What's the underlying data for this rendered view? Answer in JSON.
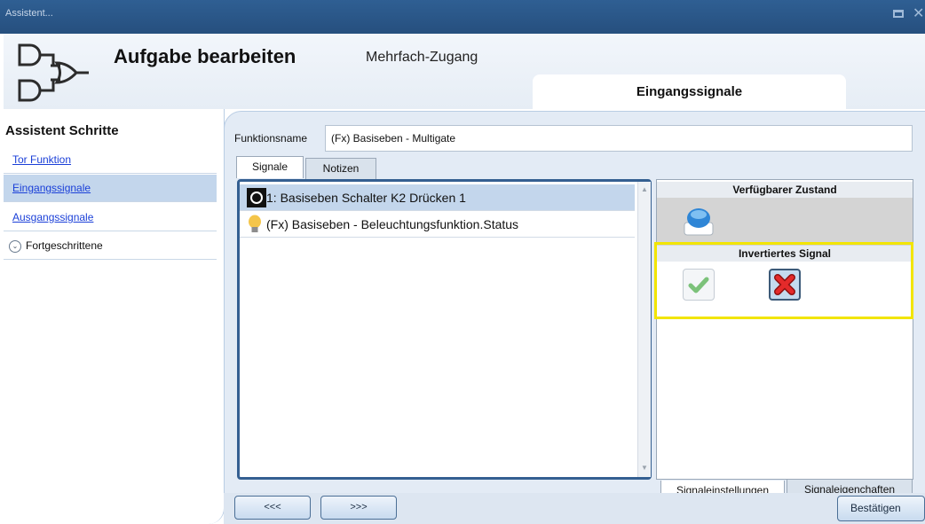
{
  "window": {
    "title": "Assistent...",
    "maximize_icon": "maximize-icon",
    "close_icon": "close-icon"
  },
  "header": {
    "logo_icon": "logic-gate-icon",
    "title": "Aufgabe bearbeiten",
    "subtitle": "Mehrfach-Zugang",
    "section_tab": "Eingangssignale"
  },
  "sidebar": {
    "title": "Assistent Schritte",
    "items": [
      {
        "label": "Tor Funktion",
        "type": "link",
        "active": false
      },
      {
        "label": "Eingangssignale",
        "type": "link",
        "active": true
      },
      {
        "label": "Ausgangssignale",
        "type": "link",
        "active": false
      },
      {
        "label": "Fortgeschrittene",
        "type": "expander",
        "active": false,
        "icon": "chevron-down-icon"
      }
    ]
  },
  "function_name": {
    "label": "Funktionsname",
    "value": "(Fx) Basiseben - Multigate"
  },
  "tabs": [
    {
      "label": "Signale",
      "selected": true
    },
    {
      "label": "Notizen",
      "selected": false
    }
  ],
  "signals": [
    {
      "label": "1: Basiseben Schalter K2 Drücken 1",
      "icon": "push-button-icon",
      "selected": true
    },
    {
      "label": "(Fx) Basiseben - Beleuchtungsfunktion.Status",
      "icon": "light-bulb-icon",
      "selected": false
    }
  ],
  "state_panel": {
    "available_state_title": "Verfügbarer Zustand",
    "state_icon": "blue-button-icon",
    "inverted_title": "Invertiertes Signal",
    "check_icon": "checkmark-icon",
    "cross_icon": "cross-icon",
    "inverted_selection": "cross",
    "tabs": [
      {
        "label": "Signaleinstellungen",
        "selected": true
      },
      {
        "label": "Signaleigenchaften",
        "selected": false
      }
    ]
  },
  "navigation": {
    "back_label": "<<<",
    "forward_label": ">>>",
    "confirm_label": "Bestätigen"
  },
  "colors": {
    "titlebar": "#2b5a8c",
    "accent_blue": "#345f91",
    "selection": "#c3d6ec",
    "highlight_yellow": "#f2e500",
    "link": "#1a3fd8",
    "cross_red": "#d81f1f"
  }
}
